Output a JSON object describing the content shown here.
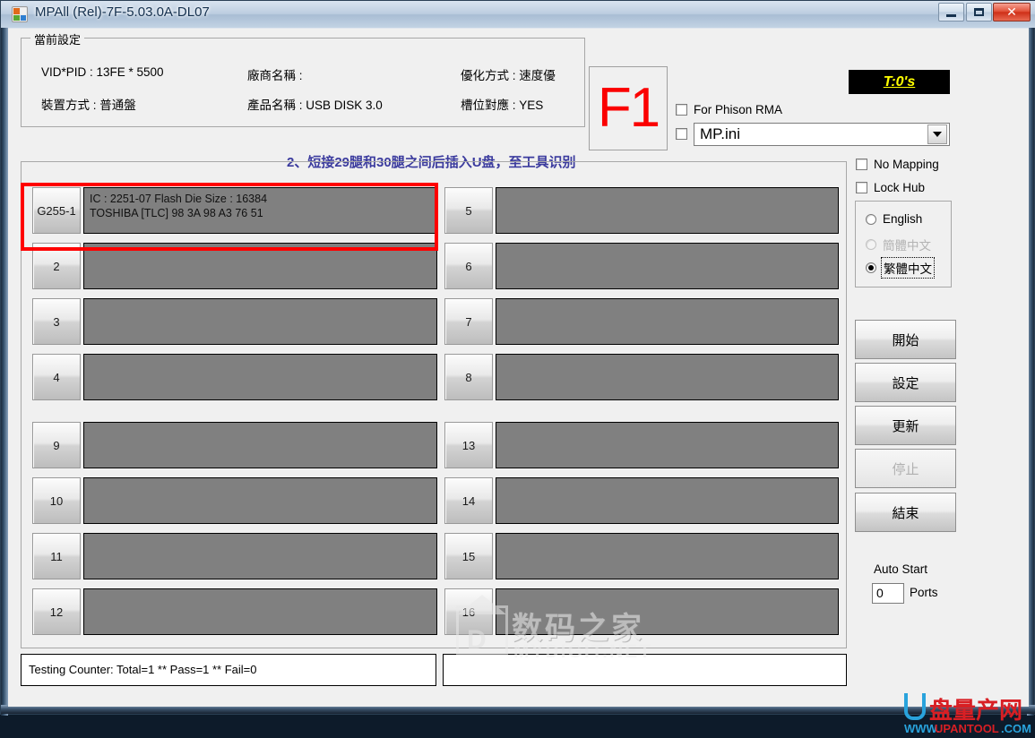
{
  "window": {
    "title": "MPAll (Rel)-7F-5.03.0A-DL07",
    "icon": "app-icon",
    "minimize": "–",
    "maximize": "□",
    "close": "✕"
  },
  "settings": {
    "legend": "當前設定",
    "vid_pid": "VID*PID : 13FE * 5500",
    "device_mode": "裝置方式 : 普通盤",
    "vendor_name": "廠商名稱 :",
    "product_name": "產品名稱 : USB DISK 3.0",
    "optimize_mode": "優化方式 : 速度優",
    "slot_mapping": "槽位對應 : YES"
  },
  "f1": {
    "label": "F1"
  },
  "timer": {
    "text": "T:0's"
  },
  "options": {
    "for_phison_rma": "For Phison RMA",
    "ini_checkbox": "",
    "ini_value": "MP.ini",
    "no_mapping": "No Mapping",
    "lock_hub": "Lock Hub"
  },
  "language": {
    "english": "English",
    "simplified": "簡體中文",
    "traditional": "繁體中文"
  },
  "annotation": {
    "text": "2、短接29腿和30腿之间后插入U盘，至工具识别"
  },
  "slots": {
    "left": [
      {
        "id": "G255-1",
        "line1": "IC : 2251-07  Flash Die Size : 16384",
        "line2": "TOSHIBA [TLC] 98 3A 98 A3 76 51"
      },
      {
        "id": "2",
        "line1": "",
        "line2": ""
      },
      {
        "id": "3",
        "line1": "",
        "line2": ""
      },
      {
        "id": "4",
        "line1": "",
        "line2": ""
      },
      {
        "id": "9",
        "line1": "",
        "line2": ""
      },
      {
        "id": "10",
        "line1": "",
        "line2": ""
      },
      {
        "id": "11",
        "line1": "",
        "line2": ""
      },
      {
        "id": "12",
        "line1": "",
        "line2": ""
      }
    ],
    "right": [
      {
        "id": "5",
        "line1": "",
        "line2": ""
      },
      {
        "id": "6",
        "line1": "",
        "line2": ""
      },
      {
        "id": "7",
        "line1": "",
        "line2": ""
      },
      {
        "id": "8",
        "line1": "",
        "line2": ""
      },
      {
        "id": "13",
        "line1": "",
        "line2": ""
      },
      {
        "id": "14",
        "line1": "",
        "line2": ""
      },
      {
        "id": "15",
        "line1": "",
        "line2": ""
      },
      {
        "id": "16",
        "line1": "",
        "line2": ""
      }
    ]
  },
  "actions": {
    "start": "開始",
    "settings": "設定",
    "update": "更新",
    "stop": "停止",
    "exit": "結束"
  },
  "autostart": {
    "label": "Auto Start",
    "value": "0",
    "unit": "Ports"
  },
  "status": {
    "left": "Testing Counter: Total=1 ** Pass=1 ** Fail=0",
    "right": ""
  },
  "watermarks": {
    "mydigit_cn": "数码之家",
    "mydigit_en": "MYDIGIT.NET",
    "mydigit_mark": "D",
    "upantool_cn": "盘量产网",
    "upantool_www": "WWW.",
    "upantool_domain": "UPANTOOL",
    "upantool_tld": ".COM"
  },
  "colors": {
    "accent_red": "#fb0000",
    "timer_yellow": "#ffff00",
    "annotation_blue": "#3b3b9e",
    "panel_gray": "#808080",
    "highlight_box": "#ff0000"
  }
}
